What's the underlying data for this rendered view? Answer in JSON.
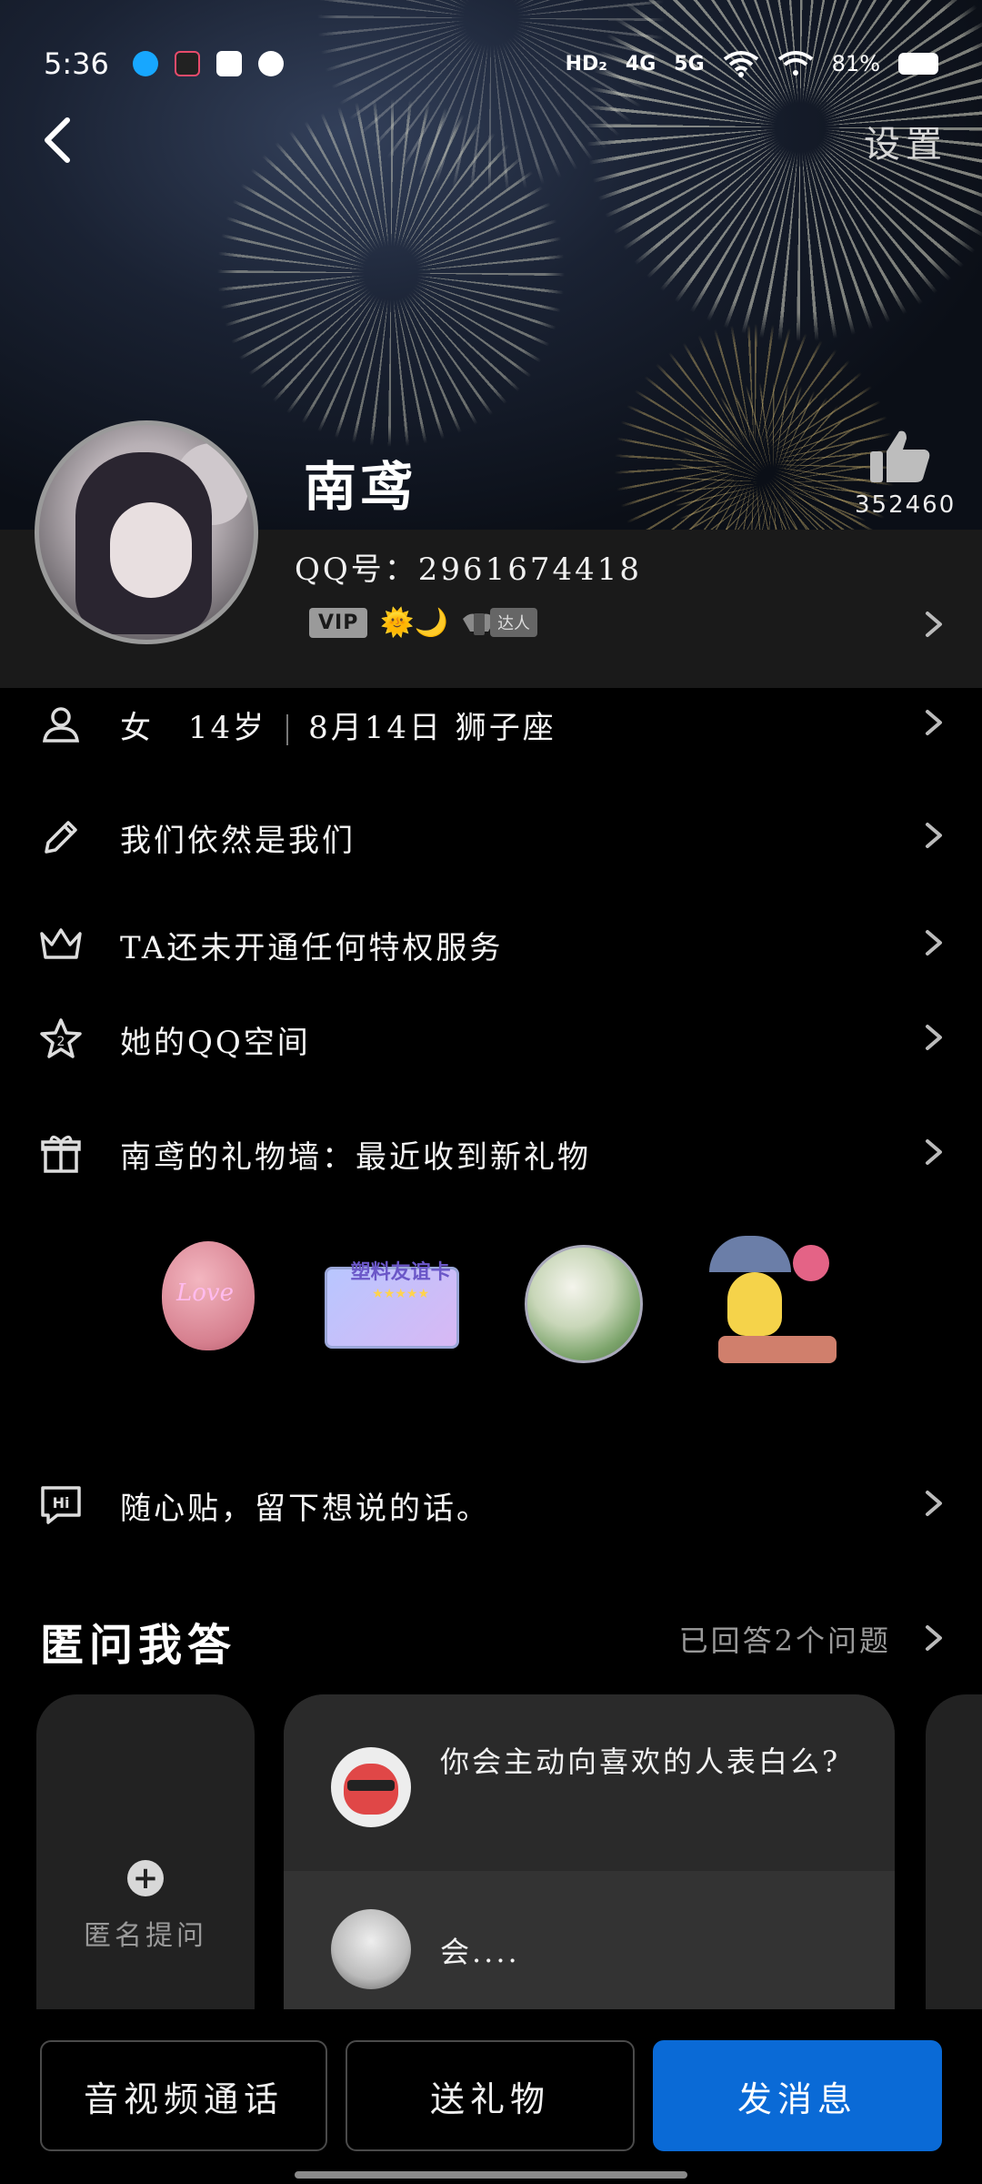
{
  "status_bar": {
    "time": "5:36",
    "signal_hd": "HD₂",
    "signal_4g": "4G",
    "signal_5g": "5G",
    "battery": "81%"
  },
  "header": {
    "settings_label": "设置"
  },
  "profile": {
    "nickname": "南鸢",
    "qq_line": "QQ号：2961674418",
    "vip_badge": "VIP",
    "talent_badge": "达人",
    "likes": "352460"
  },
  "info_rows": {
    "basic": {
      "gender": "女",
      "age": "14岁",
      "birthday_sign": "8月14日 狮子座"
    },
    "signature": "我们依然是我们",
    "privilege": "TA还未开通任何特权服务",
    "qzone": "她的QQ空间",
    "gift_wall": "南鸢的礼物墙：最近收到新礼物",
    "sticky_note": "随心贴，留下想说的话。"
  },
  "gifts": [
    {
      "name": "love-balloon",
      "label": "Love"
    },
    {
      "name": "plastic-friend-card",
      "label": "塑料友谊卡"
    },
    {
      "name": "snow-globe",
      "label": ""
    },
    {
      "name": "rain-bear",
      "label": ""
    }
  ],
  "qa": {
    "title": "匿问我答",
    "answered_count": "已回答2个问题",
    "ask_label": "匿名提问",
    "question": "你会主动向喜欢的人表白么?",
    "answer": "会...."
  },
  "bottom_bar": {
    "video_call": "音视频通话",
    "send_gift": "送礼物",
    "send_message": "发消息"
  },
  "colors": {
    "primary": "#0a6ad6",
    "background": "#000000",
    "band": "#1a1a1a"
  }
}
